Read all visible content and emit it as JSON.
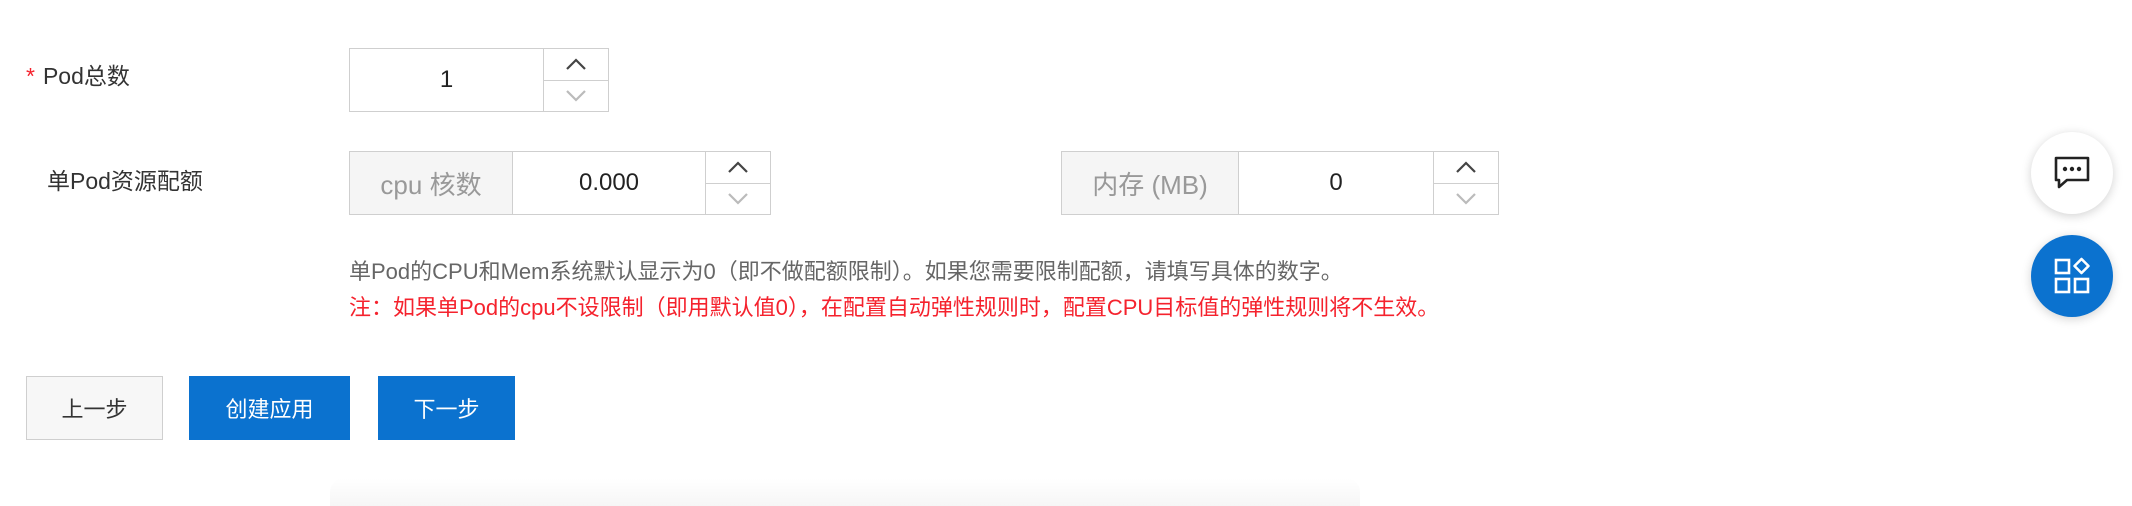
{
  "form": {
    "pod_total": {
      "required_mark": "*",
      "label": "Pod总数",
      "value": "1"
    },
    "pod_resource": {
      "label": "单Pod资源配额",
      "cpu": {
        "addon": "cpu 核数",
        "value": "0.000"
      },
      "memory": {
        "addon": "内存 (MB)",
        "value": "0"
      }
    },
    "hint_default": "单Pod的CPU和Mem系统默认显示为0（即不做配额限制）。如果您需要限制配额，请填写具体的数字。",
    "hint_warning": "注：如果单Pod的cpu不设限制（即用默认值0），在配置自动弹性规则时，配置CPU目标值的弹性规则将不生效。"
  },
  "actions": {
    "prev_label": "上一步",
    "create_label": "创建应用",
    "next_label": "下一步"
  },
  "floating": {
    "feedback_icon": "chat-icon",
    "apps_icon": "apps-icon"
  },
  "colors": {
    "primary": "#0b72cf",
    "danger": "#f5222d"
  }
}
